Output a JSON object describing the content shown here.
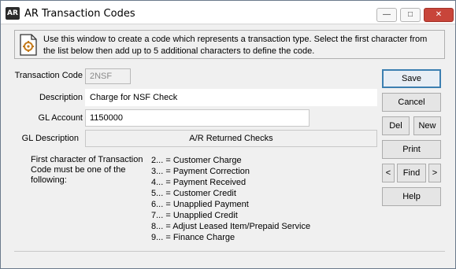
{
  "window": {
    "icon_text": "AR",
    "title": "AR Transaction Codes",
    "controls": {
      "minimize": "—",
      "maximize": "□",
      "close": "✕"
    }
  },
  "info": {
    "icon": "document-gear-icon",
    "text": "Use this window to create a code which represents a transaction type.  Select the first character from the list below then add up to 5 additional characters to define the code."
  },
  "form": {
    "transaction_code_label": "Transaction Code",
    "transaction_code_value": "2NSF",
    "description_label": "Description",
    "description_value": "Charge for NSF Check",
    "gl_account_label": "GL Account",
    "gl_account_value": "1150000",
    "gl_description_label": "GL Description",
    "gl_description_value": "A/R Returned Checks"
  },
  "note": "First character of Transaction Code must be one of the following:",
  "codes": [
    "2... = Customer Charge",
    "3... = Payment Correction",
    "4... = Payment Received",
    "5... = Customer Credit",
    "6... = Unapplied Payment",
    "7... = Unapplied Credit",
    "8... = Adjust Leased Item/Prepaid Service",
    "9... = Finance Charge"
  ],
  "buttons": {
    "save": "Save",
    "cancel": "Cancel",
    "del": "Del",
    "new": "New",
    "print": "Print",
    "prev": "<",
    "find": "Find",
    "next": ">",
    "help": "Help"
  }
}
